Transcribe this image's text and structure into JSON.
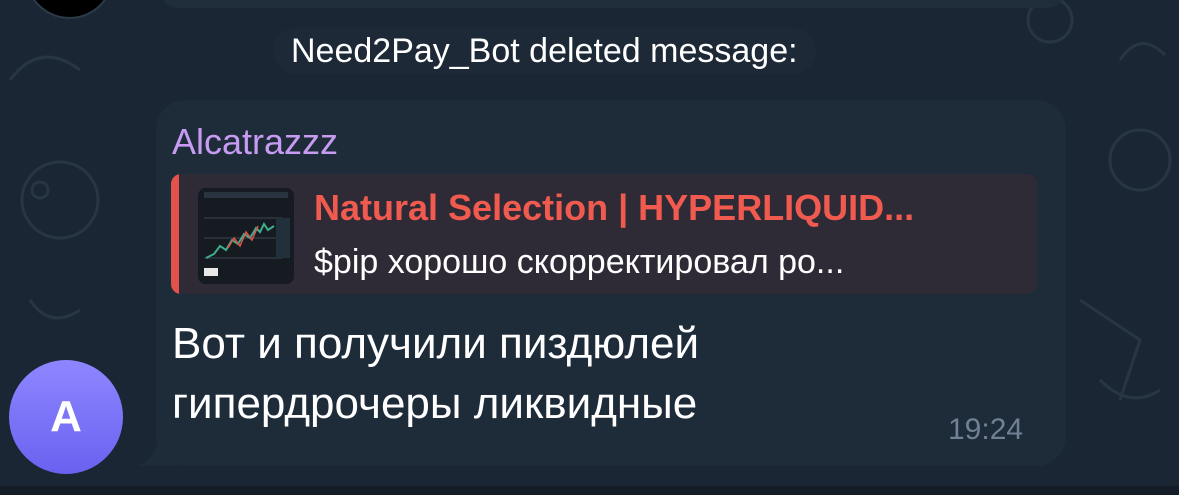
{
  "service_message": "Need2Pay_Bot deleted message:",
  "message": {
    "sender": "Alcatrazzz",
    "reply": {
      "title": "Natural Selection | HYPERLIQUID...",
      "text": "$pip хорошо скорректировал ро..."
    },
    "text_line1": "Вот и получили пиздюлей",
    "text_line2": "гипердрочеры ликвидные",
    "time": "19:24"
  },
  "avatar": {
    "initial": "A",
    "color": "#7a72f8"
  },
  "colors": {
    "sender": "#c89bf2",
    "reply_accent": "#f05a4f",
    "bubble": "#1e2c3a",
    "background": "#1a2634"
  }
}
